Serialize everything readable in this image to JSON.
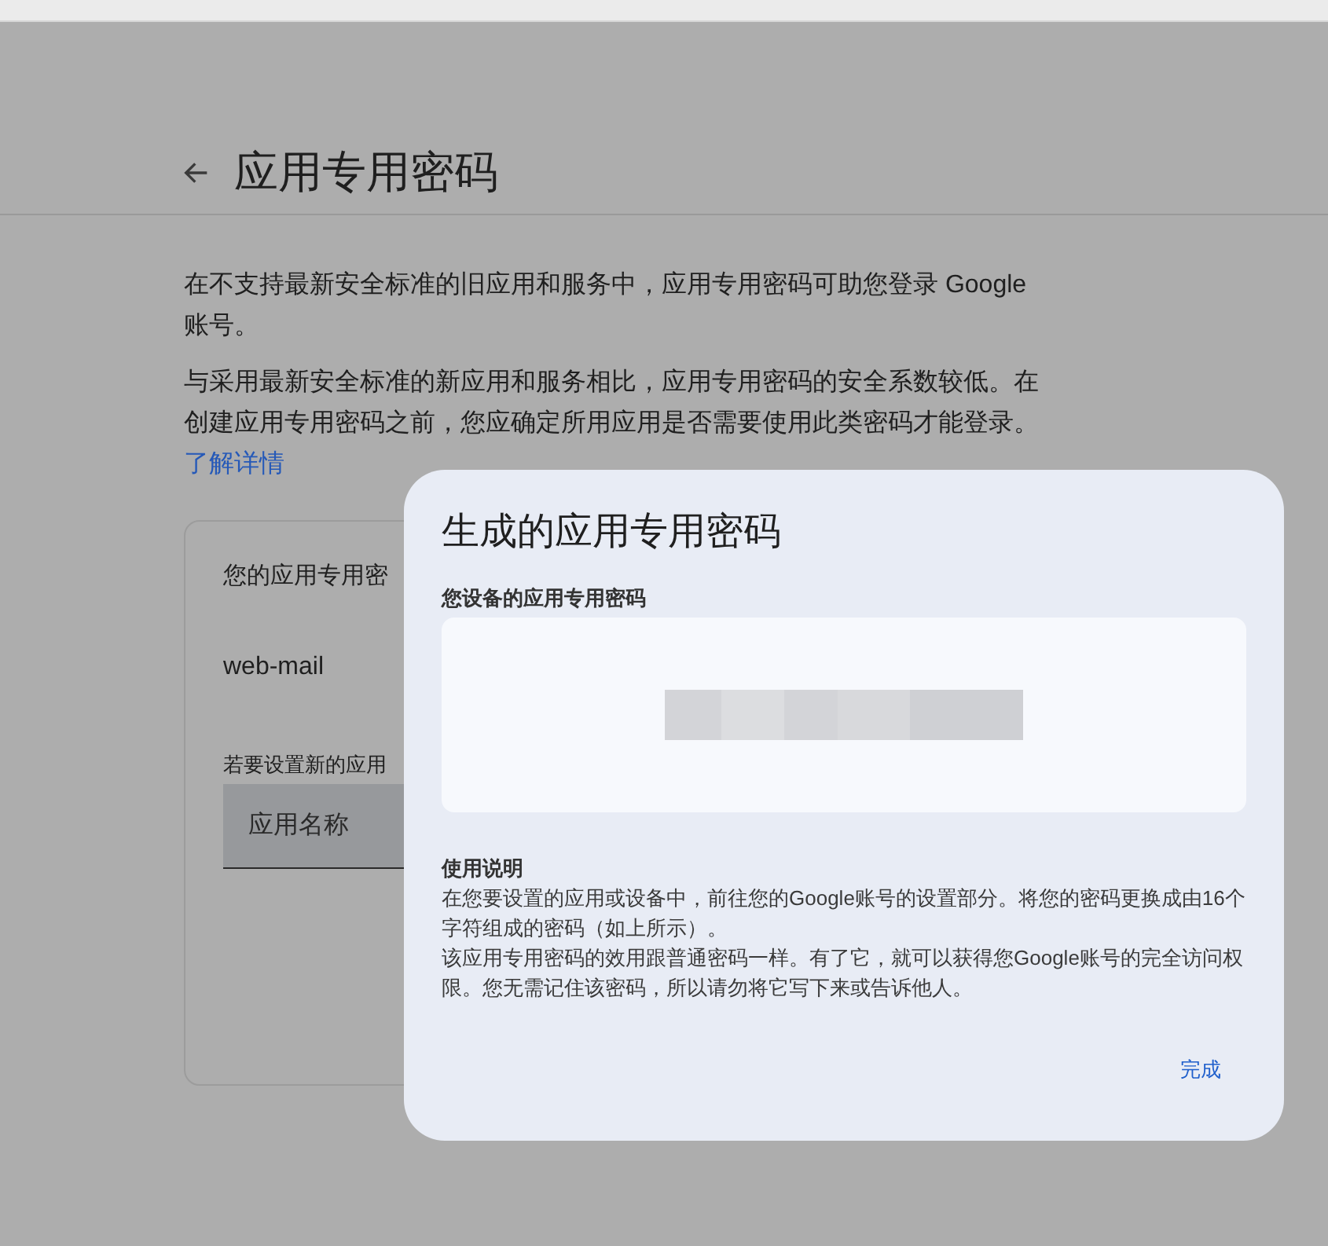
{
  "page": {
    "title": "应用专用密码",
    "paragraphs": [
      "在不支持最新安全标准的旧应用和服务中，应用专用密码可助您登录 Google 账号。",
      "与采用最新安全标准的新应用和服务相比，应用专用密码的安全系数较低。在创建应用专用密码之前，您应确定所用应用是否需要使用此类密码才能登录。"
    ],
    "link": "了解详情",
    "card": {
      "heading": "您的应用专用密",
      "apps": [
        "web-mail"
      ],
      "create_label": "若要设置新的应用",
      "field": {
        "placeholder": "应用名称"
      }
    }
  },
  "dialog": {
    "title": "生成的应用专用密码",
    "password_label": "您设备的应用专用密码",
    "instructions_title": "使用说明",
    "instructions": [
      "在您要设置的应用或设备中，前往您的Google账号的设置部分。将您的密码更换成由16个字符组成的密码（如上所示）。",
      "该应用专用密码的效用跟普通密码一样。有了它，就可以获得您Google账号的完全访问权限。您无需记住该密码，所以请勿将它写下来或告诉他人。"
    ],
    "button": "完成"
  }
}
